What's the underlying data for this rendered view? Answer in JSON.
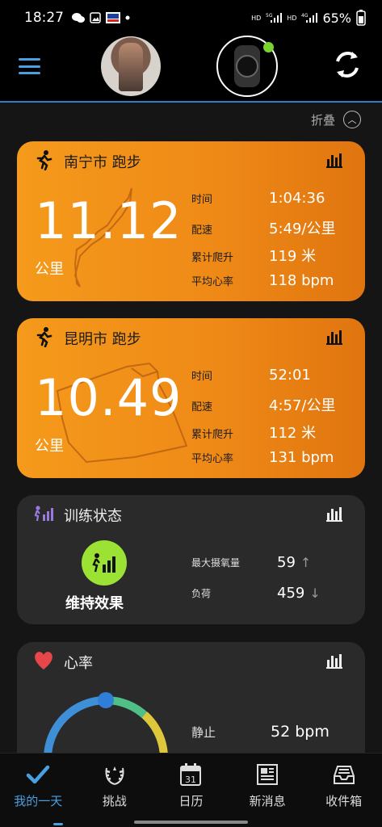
{
  "status_bar": {
    "time": "18:27",
    "battery": "65%"
  },
  "header": {
    "menu_icon": "hamburger-icon",
    "sync_icon": "sync-icon"
  },
  "fold": {
    "label": "折叠"
  },
  "activities": [
    {
      "title": "南宁市 跑步",
      "distance": "11.12",
      "unit": "公里",
      "stats": [
        {
          "label": "时间",
          "value": "1:04:36"
        },
        {
          "label": "配速",
          "value": "5:49/公里"
        },
        {
          "label": "累计爬升",
          "value": "119 米"
        },
        {
          "label": "平均心率",
          "value": "118 bpm"
        }
      ]
    },
    {
      "title": "昆明市 跑步",
      "distance": "10.49",
      "unit": "公里",
      "stats": [
        {
          "label": "时间",
          "value": "52:01"
        },
        {
          "label": "配速",
          "value": "4:57/公里"
        },
        {
          "label": "累计爬升",
          "value": "112 米"
        },
        {
          "label": "平均心率",
          "value": "131 bpm"
        }
      ]
    }
  ],
  "training_status": {
    "title": "训练状态",
    "status": "维持效果",
    "stats": [
      {
        "label": "最大摄氧量",
        "value": "59",
        "trend": "↑"
      },
      {
        "label": "负荷",
        "value": "459",
        "trend": "↓"
      }
    ]
  },
  "heart_rate": {
    "title": "心率",
    "resting_label": "静止",
    "resting_value": "52 bpm"
  },
  "tabs": [
    {
      "label": "我的一天",
      "icon": "check-icon"
    },
    {
      "label": "挑战",
      "icon": "laurel-icon"
    },
    {
      "label": "日历",
      "icon": "calendar-icon",
      "day": "31"
    },
    {
      "label": "新消息",
      "icon": "newspaper-icon"
    },
    {
      "label": "收件箱",
      "icon": "inbox-icon"
    }
  ],
  "colors": {
    "accent": "#4a9fe0",
    "activity_card": "#f0891a",
    "training_badge": "#9be235",
    "heart": "#e8474a"
  }
}
